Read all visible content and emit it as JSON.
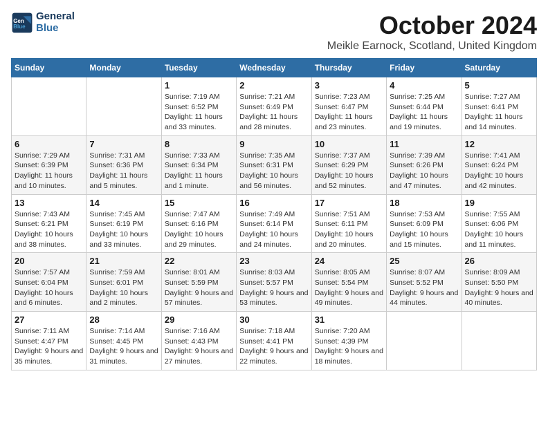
{
  "logo": {
    "line1": "General",
    "line2": "Blue"
  },
  "title": "October 2024",
  "location": "Meikle Earnock, Scotland, United Kingdom",
  "weekdays": [
    "Sunday",
    "Monday",
    "Tuesday",
    "Wednesday",
    "Thursday",
    "Friday",
    "Saturday"
  ],
  "weeks": [
    [
      null,
      null,
      {
        "day": "1",
        "sunrise": "Sunrise: 7:19 AM",
        "sunset": "Sunset: 6:52 PM",
        "daylight": "Daylight: 11 hours and 33 minutes."
      },
      {
        "day": "2",
        "sunrise": "Sunrise: 7:21 AM",
        "sunset": "Sunset: 6:49 PM",
        "daylight": "Daylight: 11 hours and 28 minutes."
      },
      {
        "day": "3",
        "sunrise": "Sunrise: 7:23 AM",
        "sunset": "Sunset: 6:47 PM",
        "daylight": "Daylight: 11 hours and 23 minutes."
      },
      {
        "day": "4",
        "sunrise": "Sunrise: 7:25 AM",
        "sunset": "Sunset: 6:44 PM",
        "daylight": "Daylight: 11 hours and 19 minutes."
      },
      {
        "day": "5",
        "sunrise": "Sunrise: 7:27 AM",
        "sunset": "Sunset: 6:41 PM",
        "daylight": "Daylight: 11 hours and 14 minutes."
      }
    ],
    [
      {
        "day": "6",
        "sunrise": "Sunrise: 7:29 AM",
        "sunset": "Sunset: 6:39 PM",
        "daylight": "Daylight: 11 hours and 10 minutes."
      },
      {
        "day": "7",
        "sunrise": "Sunrise: 7:31 AM",
        "sunset": "Sunset: 6:36 PM",
        "daylight": "Daylight: 11 hours and 5 minutes."
      },
      {
        "day": "8",
        "sunrise": "Sunrise: 7:33 AM",
        "sunset": "Sunset: 6:34 PM",
        "daylight": "Daylight: 11 hours and 1 minute."
      },
      {
        "day": "9",
        "sunrise": "Sunrise: 7:35 AM",
        "sunset": "Sunset: 6:31 PM",
        "daylight": "Daylight: 10 hours and 56 minutes."
      },
      {
        "day": "10",
        "sunrise": "Sunrise: 7:37 AM",
        "sunset": "Sunset: 6:29 PM",
        "daylight": "Daylight: 10 hours and 52 minutes."
      },
      {
        "day": "11",
        "sunrise": "Sunrise: 7:39 AM",
        "sunset": "Sunset: 6:26 PM",
        "daylight": "Daylight: 10 hours and 47 minutes."
      },
      {
        "day": "12",
        "sunrise": "Sunrise: 7:41 AM",
        "sunset": "Sunset: 6:24 PM",
        "daylight": "Daylight: 10 hours and 42 minutes."
      }
    ],
    [
      {
        "day": "13",
        "sunrise": "Sunrise: 7:43 AM",
        "sunset": "Sunset: 6:21 PM",
        "daylight": "Daylight: 10 hours and 38 minutes."
      },
      {
        "day": "14",
        "sunrise": "Sunrise: 7:45 AM",
        "sunset": "Sunset: 6:19 PM",
        "daylight": "Daylight: 10 hours and 33 minutes."
      },
      {
        "day": "15",
        "sunrise": "Sunrise: 7:47 AM",
        "sunset": "Sunset: 6:16 PM",
        "daylight": "Daylight: 10 hours and 29 minutes."
      },
      {
        "day": "16",
        "sunrise": "Sunrise: 7:49 AM",
        "sunset": "Sunset: 6:14 PM",
        "daylight": "Daylight: 10 hours and 24 minutes."
      },
      {
        "day": "17",
        "sunrise": "Sunrise: 7:51 AM",
        "sunset": "Sunset: 6:11 PM",
        "daylight": "Daylight: 10 hours and 20 minutes."
      },
      {
        "day": "18",
        "sunrise": "Sunrise: 7:53 AM",
        "sunset": "Sunset: 6:09 PM",
        "daylight": "Daylight: 10 hours and 15 minutes."
      },
      {
        "day": "19",
        "sunrise": "Sunrise: 7:55 AM",
        "sunset": "Sunset: 6:06 PM",
        "daylight": "Daylight: 10 hours and 11 minutes."
      }
    ],
    [
      {
        "day": "20",
        "sunrise": "Sunrise: 7:57 AM",
        "sunset": "Sunset: 6:04 PM",
        "daylight": "Daylight: 10 hours and 6 minutes."
      },
      {
        "day": "21",
        "sunrise": "Sunrise: 7:59 AM",
        "sunset": "Sunset: 6:01 PM",
        "daylight": "Daylight: 10 hours and 2 minutes."
      },
      {
        "day": "22",
        "sunrise": "Sunrise: 8:01 AM",
        "sunset": "Sunset: 5:59 PM",
        "daylight": "Daylight: 9 hours and 57 minutes."
      },
      {
        "day": "23",
        "sunrise": "Sunrise: 8:03 AM",
        "sunset": "Sunset: 5:57 PM",
        "daylight": "Daylight: 9 hours and 53 minutes."
      },
      {
        "day": "24",
        "sunrise": "Sunrise: 8:05 AM",
        "sunset": "Sunset: 5:54 PM",
        "daylight": "Daylight: 9 hours and 49 minutes."
      },
      {
        "day": "25",
        "sunrise": "Sunrise: 8:07 AM",
        "sunset": "Sunset: 5:52 PM",
        "daylight": "Daylight: 9 hours and 44 minutes."
      },
      {
        "day": "26",
        "sunrise": "Sunrise: 8:09 AM",
        "sunset": "Sunset: 5:50 PM",
        "daylight": "Daylight: 9 hours and 40 minutes."
      }
    ],
    [
      {
        "day": "27",
        "sunrise": "Sunrise: 7:11 AM",
        "sunset": "Sunset: 4:47 PM",
        "daylight": "Daylight: 9 hours and 35 minutes."
      },
      {
        "day": "28",
        "sunrise": "Sunrise: 7:14 AM",
        "sunset": "Sunset: 4:45 PM",
        "daylight": "Daylight: 9 hours and 31 minutes."
      },
      {
        "day": "29",
        "sunrise": "Sunrise: 7:16 AM",
        "sunset": "Sunset: 4:43 PM",
        "daylight": "Daylight: 9 hours and 27 minutes."
      },
      {
        "day": "30",
        "sunrise": "Sunrise: 7:18 AM",
        "sunset": "Sunset: 4:41 PM",
        "daylight": "Daylight: 9 hours and 22 minutes."
      },
      {
        "day": "31",
        "sunrise": "Sunrise: 7:20 AM",
        "sunset": "Sunset: 4:39 PM",
        "daylight": "Daylight: 9 hours and 18 minutes."
      },
      null,
      null
    ]
  ]
}
